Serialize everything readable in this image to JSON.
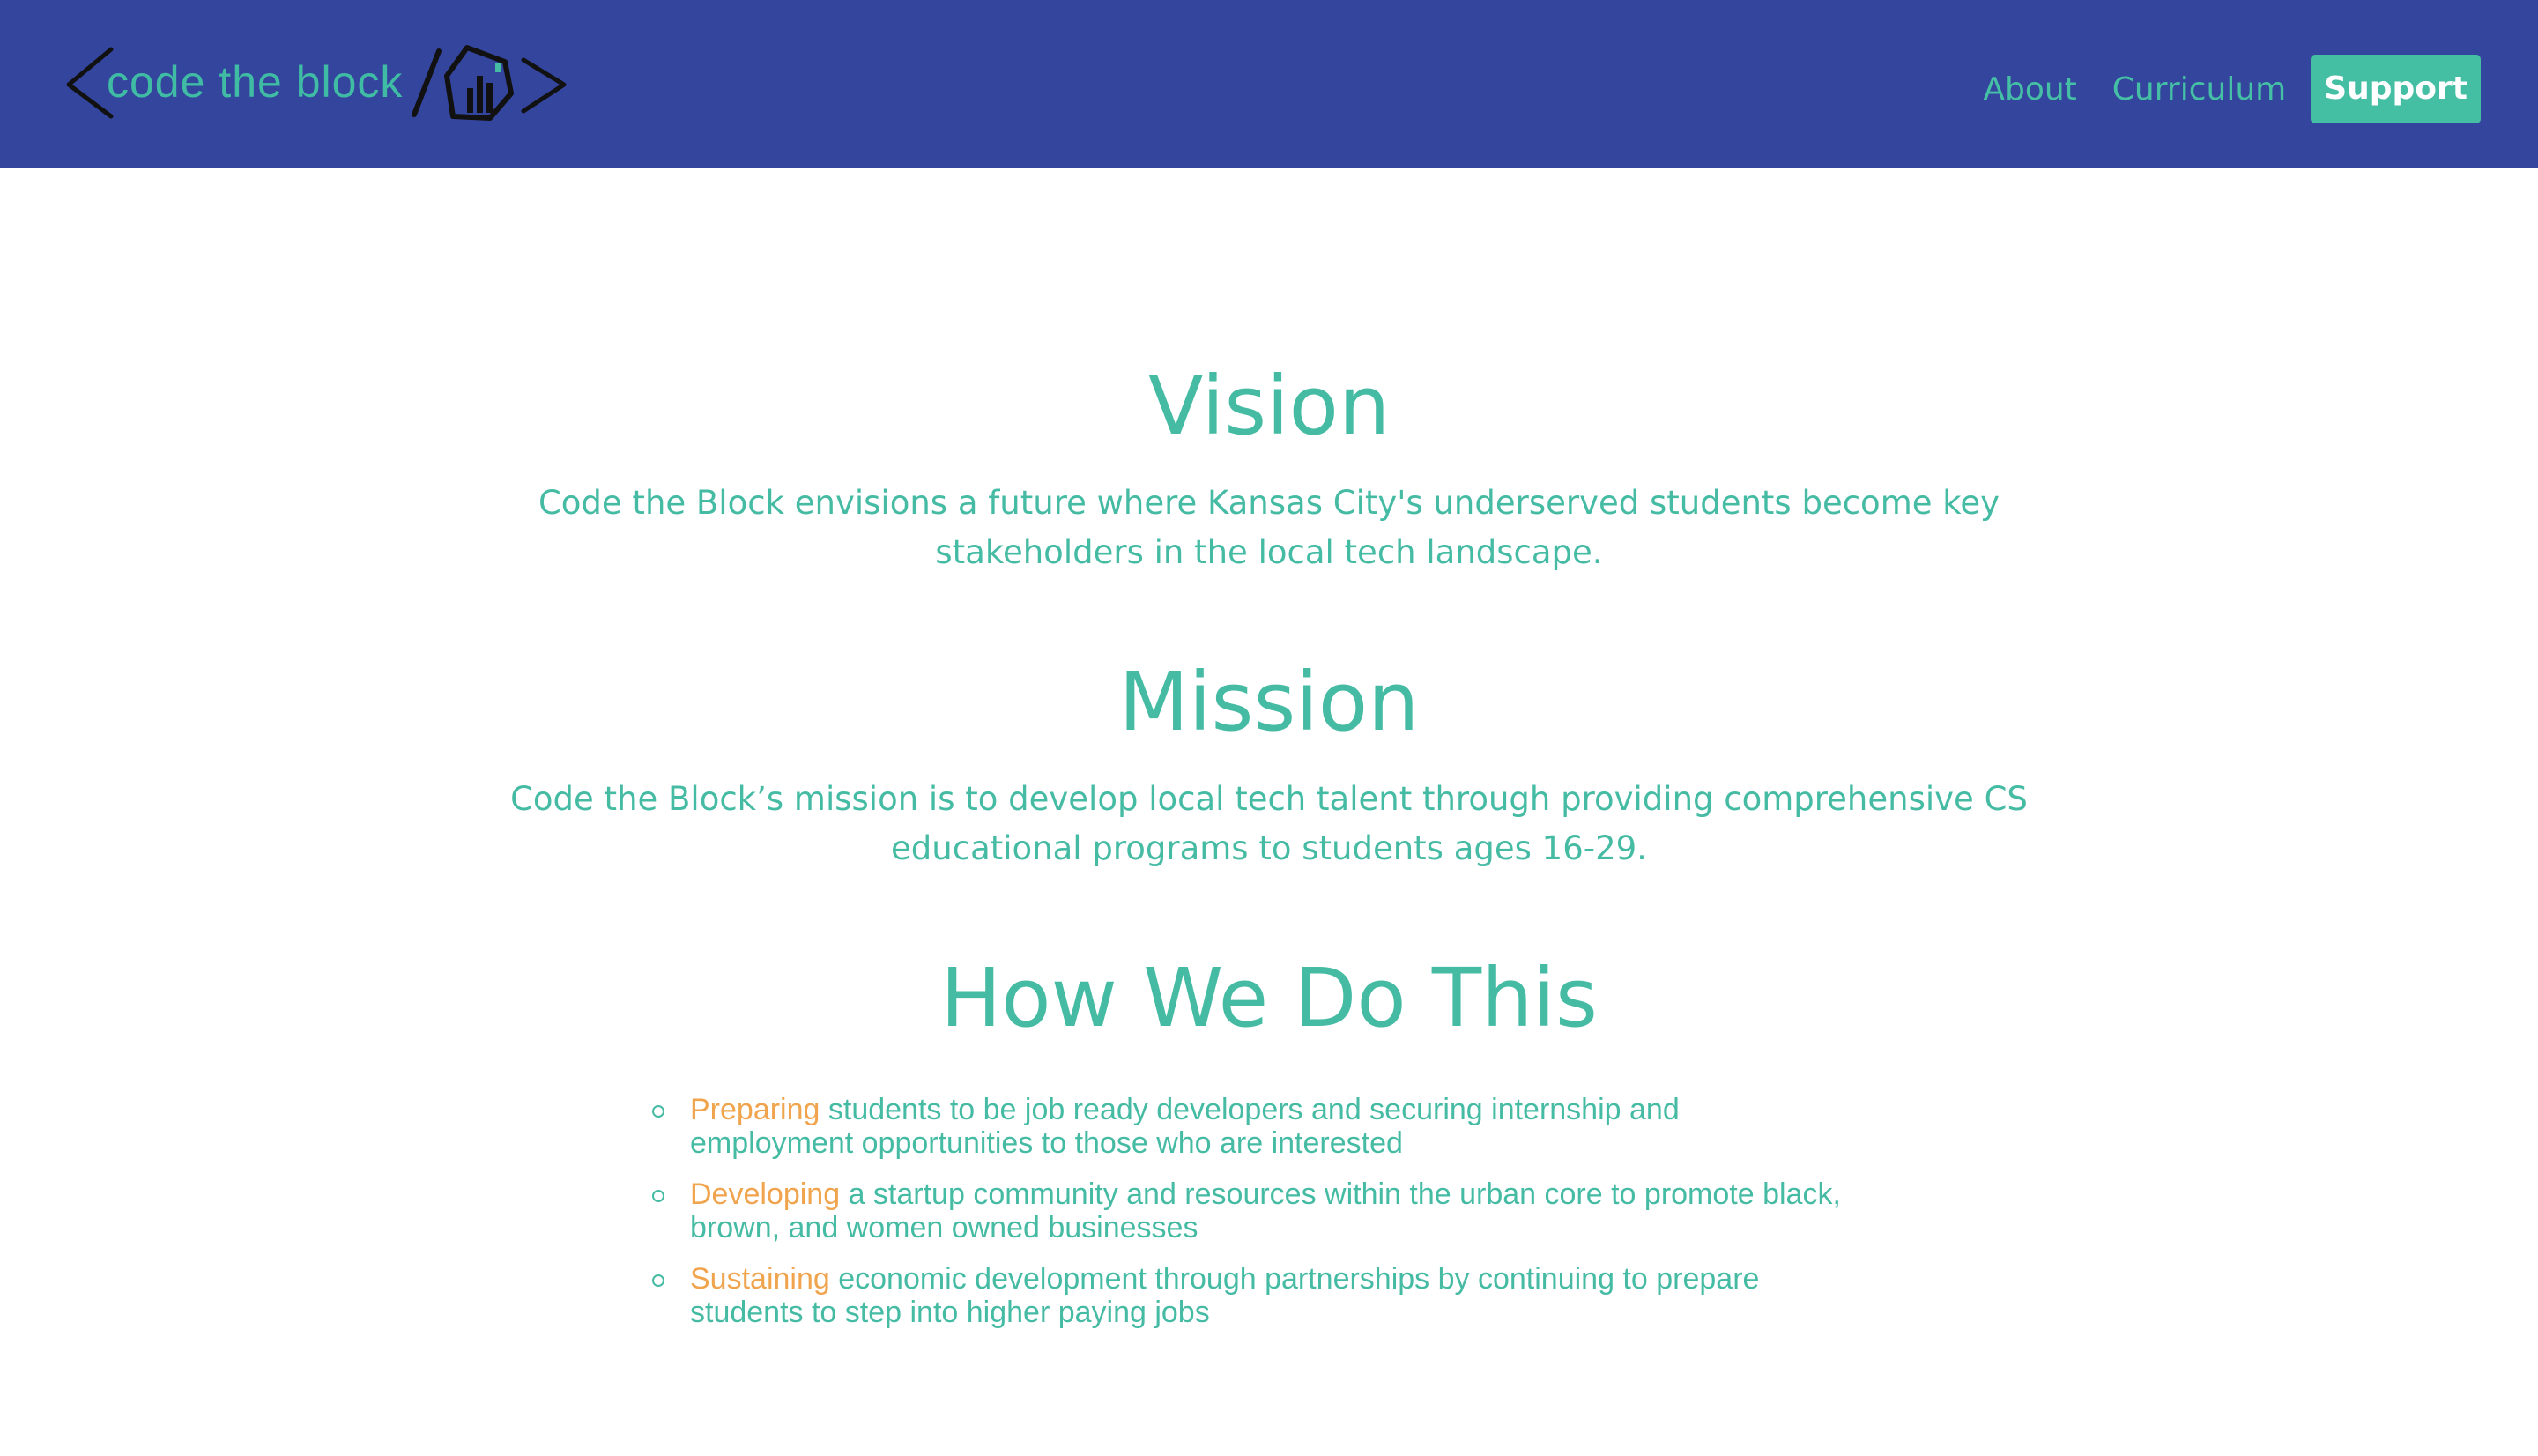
{
  "header": {
    "logo_text": "code the block",
    "nav": {
      "about": "About",
      "curriculum": "Curriculum",
      "support": "Support"
    }
  },
  "colors": {
    "navbar_bg": "#34459e",
    "teal": "#45bba4",
    "orange": "#f0a44d",
    "white": "#ffffff"
  },
  "main": {
    "vision": {
      "title": "Vision",
      "text": "Code the Block envisions a future where Kansas City's underserved students become key stakeholders in the local tech landscape."
    },
    "mission": {
      "title": "Mission",
      "text": "Code the Block’s mission is to develop local tech talent through providing comprehensive CS educational programs to students ages 16-29."
    },
    "how": {
      "title": "How We Do This",
      "items": [
        {
          "keyword": "Preparing",
          "text": " students to be job ready developers and securing internship and employment opportunities to those who are interested"
        },
        {
          "keyword": "Developing",
          "text": " a startup community and resources within the urban core to promote black, brown, and women owned businesses"
        },
        {
          "keyword": "Sustaining",
          "text": " economic development through partnerships by continuing to prepare students to step into higher paying jobs"
        }
      ]
    }
  }
}
